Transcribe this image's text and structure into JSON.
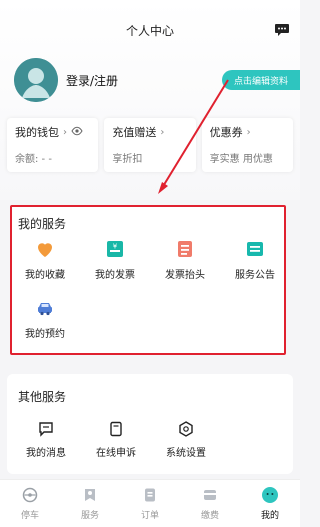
{
  "header": {
    "title": "个人中心",
    "chat_icon": "chat-icon"
  },
  "profile": {
    "login_text": "登录/注册",
    "edit_button": "点击编辑资料"
  },
  "cards": [
    {
      "title": "我的钱包",
      "sub": "余额: - -",
      "icon": "eye-icon"
    },
    {
      "title": "充值赠送",
      "sub": "享折扣",
      "icon": "chevron-right-icon"
    },
    {
      "title": "优惠券",
      "sub": "享实惠 用优惠",
      "icon": "chevron-right-icon"
    }
  ],
  "services": {
    "title": "我的服务",
    "items": [
      {
        "label": "我的收藏",
        "icon": "heart-icon"
      },
      {
        "label": "我的发票",
        "icon": "invoice-icon"
      },
      {
        "label": "发票抬头",
        "icon": "invoice-header-icon"
      },
      {
        "label": "服务公告",
        "icon": "notice-icon"
      },
      {
        "label": "我的预约",
        "icon": "car-icon"
      }
    ]
  },
  "other_services": {
    "title": "其他服务",
    "items": [
      {
        "label": "我的消息",
        "icon": "message-icon"
      },
      {
        "label": "在线申诉",
        "icon": "appeal-icon"
      },
      {
        "label": "系统设置",
        "icon": "settings-icon"
      }
    ]
  },
  "tabbar": {
    "items": [
      {
        "label": "停车",
        "icon": "steering-wheel-icon",
        "active": false
      },
      {
        "label": "服务",
        "icon": "service-icon",
        "active": false
      },
      {
        "label": "订单",
        "icon": "order-icon",
        "active": false
      },
      {
        "label": "缴费",
        "icon": "payment-icon",
        "active": false
      },
      {
        "label": "我的",
        "icon": "profile-icon",
        "active": true
      }
    ]
  },
  "colors": {
    "accent": "#2ec5bf",
    "annotation_red": "#e0212f",
    "heart_orange": "#f39a3a",
    "invoice_teal": "#19b7a7",
    "invoice_header_red": "#f07b6a",
    "notice_teal": "#17b8ad",
    "car_blue": "#4f7dd6"
  }
}
